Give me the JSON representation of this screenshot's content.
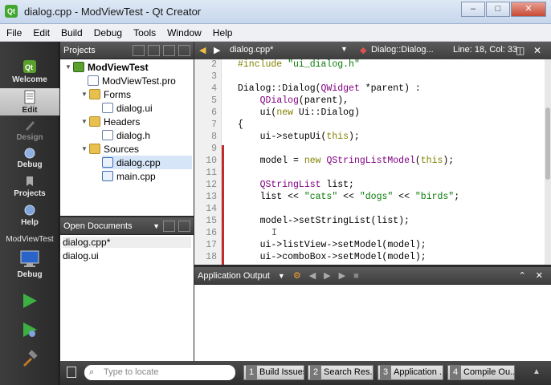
{
  "window": {
    "title": "dialog.cpp - ModViewTest - Qt Creator",
    "app_icon_text": "Qt"
  },
  "menu": [
    "File",
    "Edit",
    "Build",
    "Debug",
    "Tools",
    "Window",
    "Help"
  ],
  "modes": [
    {
      "label": "Welcome",
      "icon": "qt-welcome-icon"
    },
    {
      "label": "Edit",
      "icon": "edit-document-icon"
    },
    {
      "label": "Design",
      "icon": "design-icon"
    },
    {
      "label": "Debug",
      "icon": "debug-bug-icon"
    },
    {
      "label": "Projects",
      "icon": "projects-icon"
    },
    {
      "label": "Help",
      "icon": "help-icon"
    }
  ],
  "project_selector": {
    "label": "ModViewTest",
    "sub_label": "Debug",
    "icon": "monitor-icon"
  },
  "projects_panel": {
    "title": "Projects",
    "tree": [
      {
        "label": "ModViewTest",
        "icon": "project-icon"
      },
      {
        "label": "ModViewTest.pro",
        "icon": "pro-file-icon"
      },
      {
        "label": "Forms",
        "icon": "folder-icon"
      },
      {
        "label": "dialog.ui",
        "icon": "ui-file-icon"
      },
      {
        "label": "Headers",
        "icon": "folder-icon"
      },
      {
        "label": "dialog.h",
        "icon": "header-file-icon"
      },
      {
        "label": "Sources",
        "icon": "folder-icon"
      },
      {
        "label": "dialog.cpp",
        "icon": "cpp-file-icon"
      },
      {
        "label": "main.cpp",
        "icon": "cpp-file-icon"
      }
    ]
  },
  "open_documents": {
    "title": "Open Documents",
    "items": [
      "dialog.cpp*",
      "dialog.ui"
    ]
  },
  "editor_toolbar": {
    "file": "dialog.cpp*",
    "symbol": "Dialog::Dialog...",
    "position": "Line: 18, Col: 33"
  },
  "code": {
    "lines": [
      {
        "n": "2",
        "text": "#include \"ui_dialog.h\""
      },
      {
        "n": "3",
        "text": ""
      },
      {
        "n": "4",
        "text": "Dialog::Dialog(QWidget *parent) :"
      },
      {
        "n": "5",
        "text": "    QDialog(parent),"
      },
      {
        "n": "6",
        "text": "    ui(new Ui::Dialog)"
      },
      {
        "n": "7",
        "text": "{"
      },
      {
        "n": "8",
        "text": "    ui->setupUi(this);"
      },
      {
        "n": "9",
        "text": ""
      },
      {
        "n": "10",
        "text": "    model = new QStringListModel(this);"
      },
      {
        "n": "11",
        "text": ""
      },
      {
        "n": "12",
        "text": "    QStringList list;"
      },
      {
        "n": "13",
        "text": "    list << \"cats\" << \"dogs\" << \"birds\";"
      },
      {
        "n": "14",
        "text": ""
      },
      {
        "n": "15",
        "text": "    model->setStringList(list);"
      },
      {
        "n": "16",
        "text": ""
      },
      {
        "n": "17",
        "text": "    ui->listView->setModel(model);"
      },
      {
        "n": "18",
        "text": "    ui->comboBox->setModel(model);"
      }
    ]
  },
  "output_panel": {
    "title": "Application Output"
  },
  "statusbar": {
    "locate_placeholder": "Type to locate",
    "tabs": [
      {
        "num": "1",
        "label": "Build Issues"
      },
      {
        "num": "2",
        "label": "Search Res..."
      },
      {
        "num": "3",
        "label": "Application ..."
      },
      {
        "num": "4",
        "label": "Compile Ou..."
      }
    ]
  }
}
